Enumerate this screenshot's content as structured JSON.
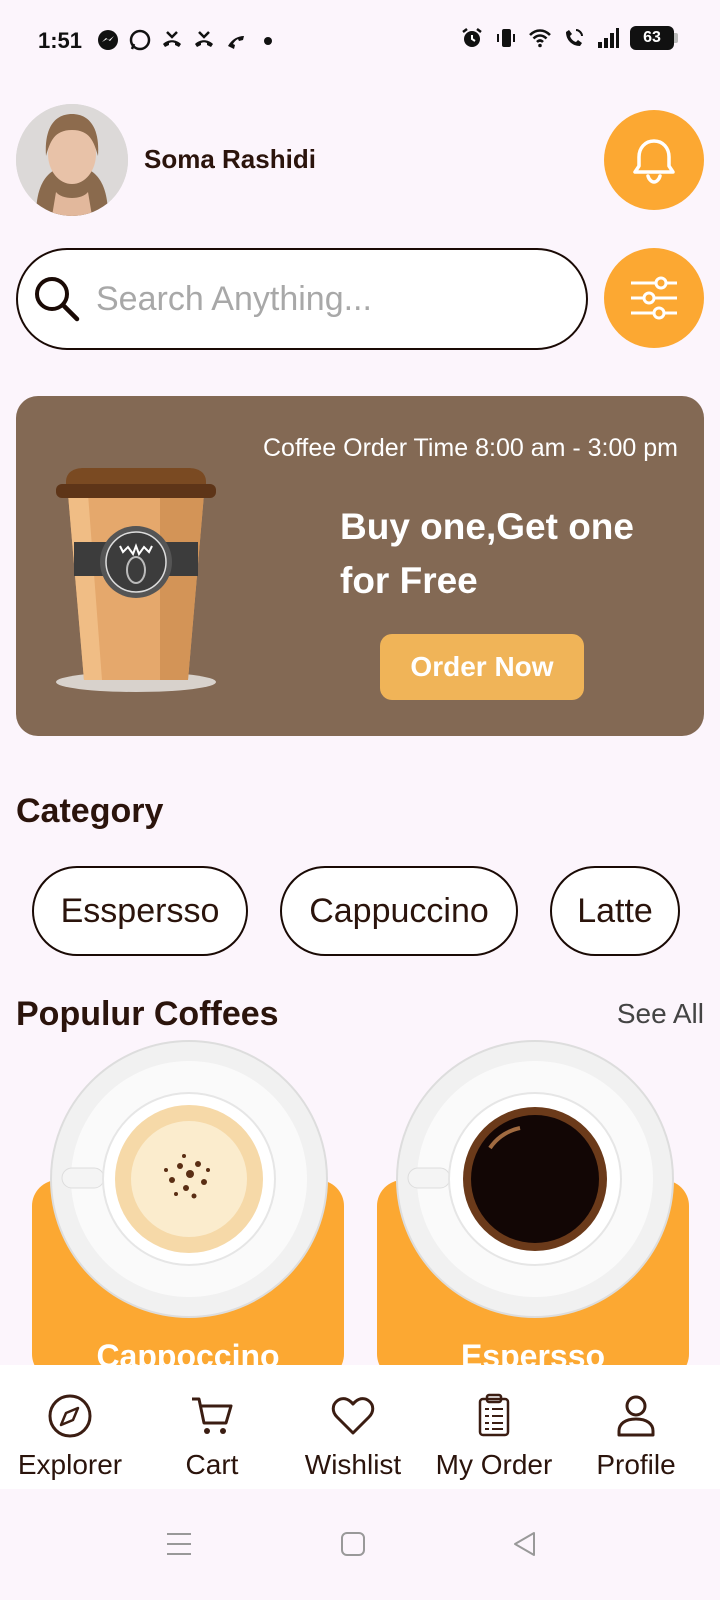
{
  "status": {
    "time": "1:51",
    "battery": "63",
    "left_icons": [
      "messenger-icon",
      "whatsapp-icon",
      "missed-call-icon",
      "missed-call-icon",
      "missed-call-icon",
      "dot-icon"
    ],
    "right_icons": [
      "alarm-icon",
      "vibrate-icon",
      "wifi-icon",
      "wifi-call-icon",
      "signal-icon"
    ]
  },
  "header": {
    "user_name": "Soma Rashidi",
    "notification_icon": "bell-icon"
  },
  "search": {
    "placeholder": "Search Anything...",
    "filter_icon": "sliders-icon"
  },
  "banner": {
    "time_text": "Coffee Order Time 8:00 am - 3:00 pm",
    "headline": "Buy one,Get one for Free",
    "cta_label": "Order Now"
  },
  "category": {
    "title": "Category",
    "items": [
      "Esspersso",
      "Cappuccino",
      "Latte"
    ]
  },
  "popular": {
    "title": "Populur Coffees",
    "see_all": "See All",
    "items": [
      {
        "name": "Cappoccino"
      },
      {
        "name": "Espersso"
      }
    ]
  },
  "bottom_nav": {
    "items": [
      {
        "label": "Explorer",
        "icon": "compass-icon"
      },
      {
        "label": "Cart",
        "icon": "cart-icon"
      },
      {
        "label": "Wishlist",
        "icon": "heart-icon"
      },
      {
        "label": "My Order",
        "icon": "clipboard-icon"
      },
      {
        "label": "Profile",
        "icon": "user-icon"
      }
    ]
  },
  "colors": {
    "accent": "#fca832",
    "banner_bg": "#836954",
    "text_dark": "#2b140c",
    "page_bg": "#fcf5fc"
  }
}
